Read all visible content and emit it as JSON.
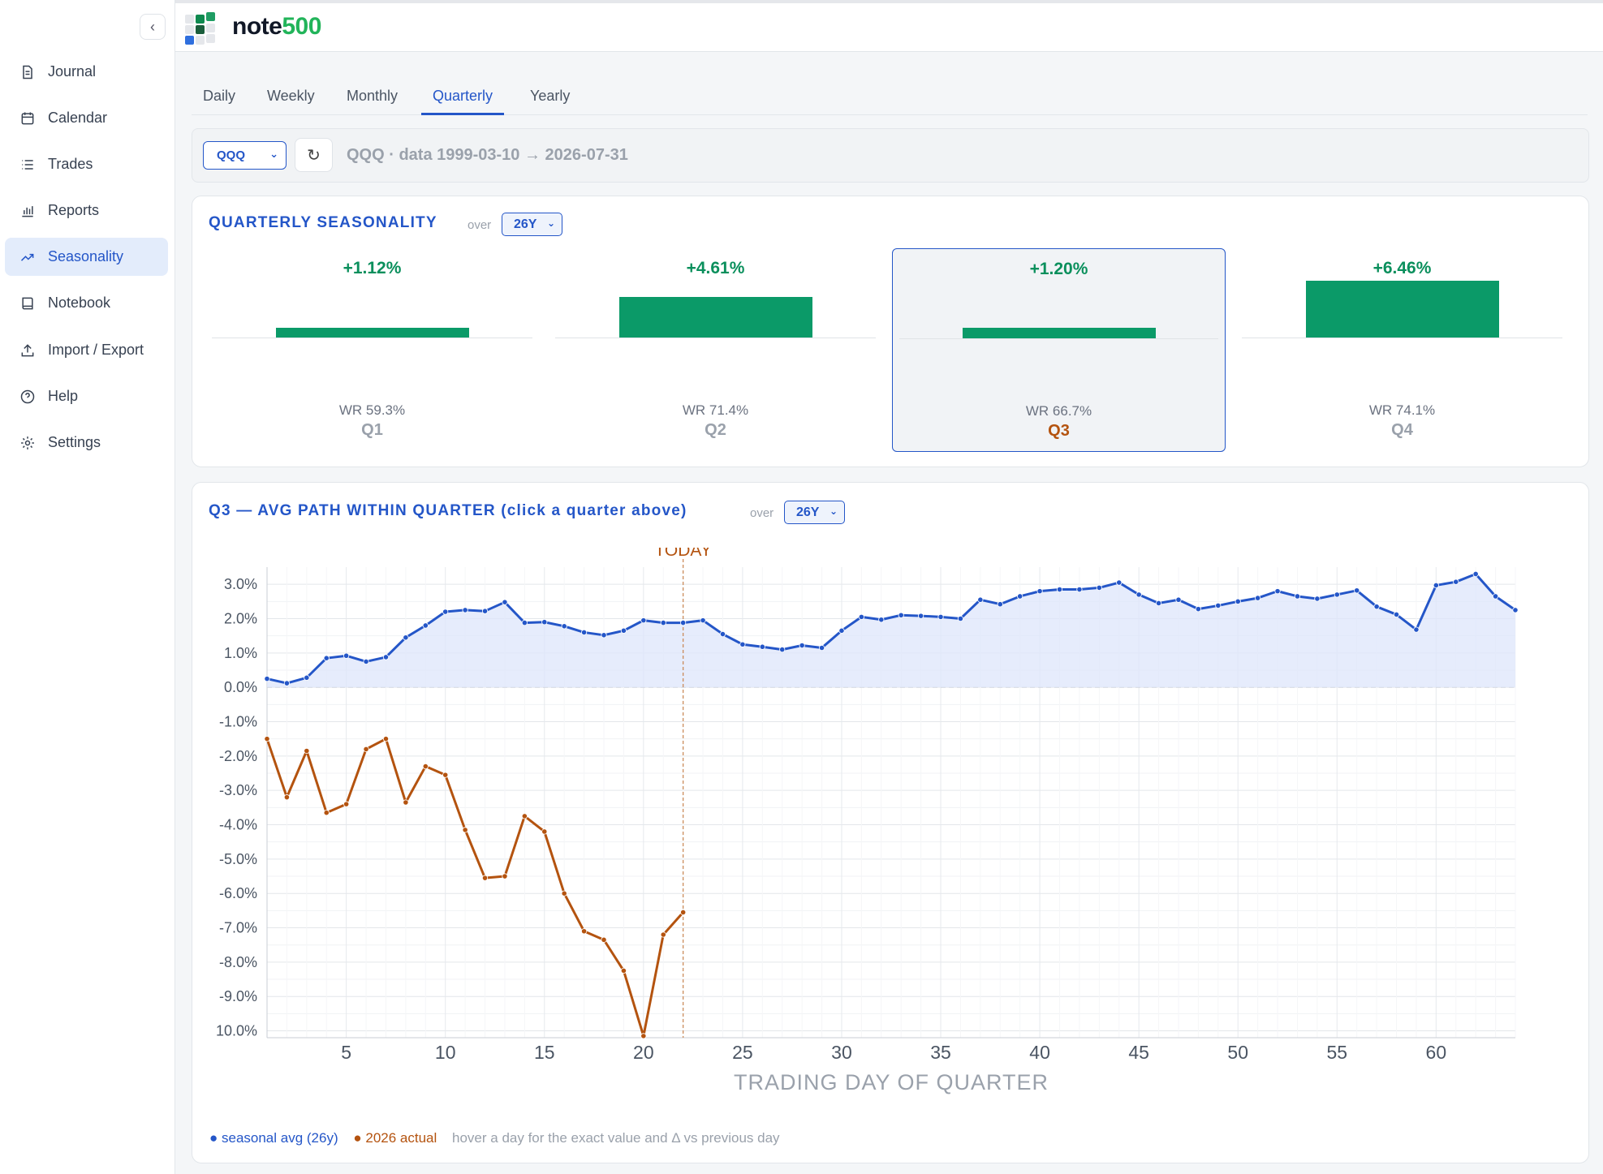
{
  "app": {
    "brand_main": "note",
    "brand_accent": "500",
    "collapse_glyph": "‹"
  },
  "sidebar": {
    "items": [
      {
        "label": "Journal",
        "icon": "document-icon"
      },
      {
        "label": "Calendar",
        "icon": "calendar-icon"
      },
      {
        "label": "Trades",
        "icon": "list-icon"
      },
      {
        "label": "Reports",
        "icon": "bar-chart-icon"
      },
      {
        "label": "Seasonality",
        "icon": "trend-up-icon",
        "active": true
      },
      {
        "label": "Notebook",
        "icon": "notebook-icon"
      },
      {
        "label": "Import / Export",
        "icon": "upload-icon"
      },
      {
        "label": "Help",
        "icon": "help-circle-icon"
      },
      {
        "label": "Settings",
        "icon": "gear-icon"
      }
    ]
  },
  "tabs": {
    "daily": "Daily",
    "weekly": "Weekly",
    "monthly": "Monthly",
    "quarterly": "Quarterly",
    "yearly": "Yearly",
    "active": "Quarterly"
  },
  "toolbar": {
    "ticker": "QQQ",
    "refresh_glyph": "↻",
    "data_range": "QQQ · data 1999-03-10 → 2026-07-31"
  },
  "seasonality": {
    "title": "QUARTERLY SEASONALITY",
    "over_label": "over",
    "range": "26Y",
    "quarters": [
      {
        "name": "Q1",
        "avg": "+1.12%",
        "avg_value": 1.12,
        "wr": "WR 59.3%"
      },
      {
        "name": "Q2",
        "avg": "+4.61%",
        "avg_value": 4.61,
        "wr": "WR 71.4%"
      },
      {
        "name": "Q3",
        "avg": "+1.20%",
        "avg_value": 1.2,
        "wr": "WR 66.7%",
        "selected": true
      },
      {
        "name": "Q4",
        "avg": "+6.46%",
        "avg_value": 6.46,
        "wr": "WR 74.1%"
      }
    ]
  },
  "path": {
    "title": "Q3 — AVG PATH WITHIN QUARTER (click a quarter above)",
    "over_label": "over",
    "range": "26Y",
    "legend_seasonal": "● seasonal avg (26y)",
    "legend_actual": "● 2026 actual",
    "legend_hint": "hover a day for the exact value and Δ vs previous day"
  },
  "colors": {
    "accent": "#2456c8",
    "positive": "#0b9a68",
    "actual": "#b4530f",
    "seasonal_fill": "#dde6fb"
  },
  "chart_data": {
    "type": "line",
    "xlabel": "TRADING DAY OF QUARTER",
    "ylabel": "",
    "today_label": "TODAY",
    "today_day": 22,
    "xlim": [
      1,
      64
    ],
    "ylim": [
      -10.2,
      3.5
    ],
    "x_ticks": [
      5,
      10,
      15,
      20,
      25,
      30,
      35,
      40,
      45,
      50,
      55,
      60
    ],
    "y_ticks": [
      3,
      2,
      1,
      0,
      -1,
      -2,
      -3,
      -4,
      -5,
      -6,
      -7,
      -8,
      -9,
      -10
    ],
    "y_tick_labels": [
      "3.0%",
      "2.0%",
      "1.0%",
      "0.0%",
      "-1.0%",
      "-2.0%",
      "-3.0%",
      "-4.0%",
      "-5.0%",
      "-6.0%",
      "-7.0%",
      "-8.0%",
      "-9.0%",
      "10.0%"
    ],
    "series": [
      {
        "name": "seasonal avg (26y)",
        "color": "#2456c8",
        "x_start": 1,
        "values": [
          0.25,
          0.12,
          0.28,
          0.85,
          0.92,
          0.75,
          0.88,
          1.45,
          1.8,
          2.2,
          2.25,
          2.22,
          2.48,
          1.88,
          1.9,
          1.78,
          1.6,
          1.52,
          1.65,
          1.95,
          1.88,
          1.88,
          1.95,
          1.55,
          1.25,
          1.18,
          1.1,
          1.22,
          1.15,
          1.65,
          2.05,
          1.97,
          2.1,
          2.08,
          2.05,
          2.0,
          2.55,
          2.42,
          2.65,
          2.8,
          2.85,
          2.85,
          2.9,
          3.05,
          2.7,
          2.45,
          2.55,
          2.28,
          2.38,
          2.5,
          2.6,
          2.8,
          2.65,
          2.58,
          2.7,
          2.82,
          2.35,
          2.12,
          1.68,
          2.97,
          3.07,
          3.3,
          2.65,
          2.25
        ]
      },
      {
        "name": "2026 actual",
        "color": "#b4530f",
        "x_start": 1,
        "values": [
          -1.5,
          -3.2,
          -1.85,
          -3.65,
          -3.4,
          -1.8,
          -1.5,
          -3.35,
          -2.3,
          -2.55,
          -4.15,
          -5.55,
          -5.5,
          -3.75,
          -4.2,
          -6.0,
          -7.1,
          -7.35,
          -8.25,
          -10.15,
          -7.2,
          -6.55
        ]
      }
    ]
  }
}
